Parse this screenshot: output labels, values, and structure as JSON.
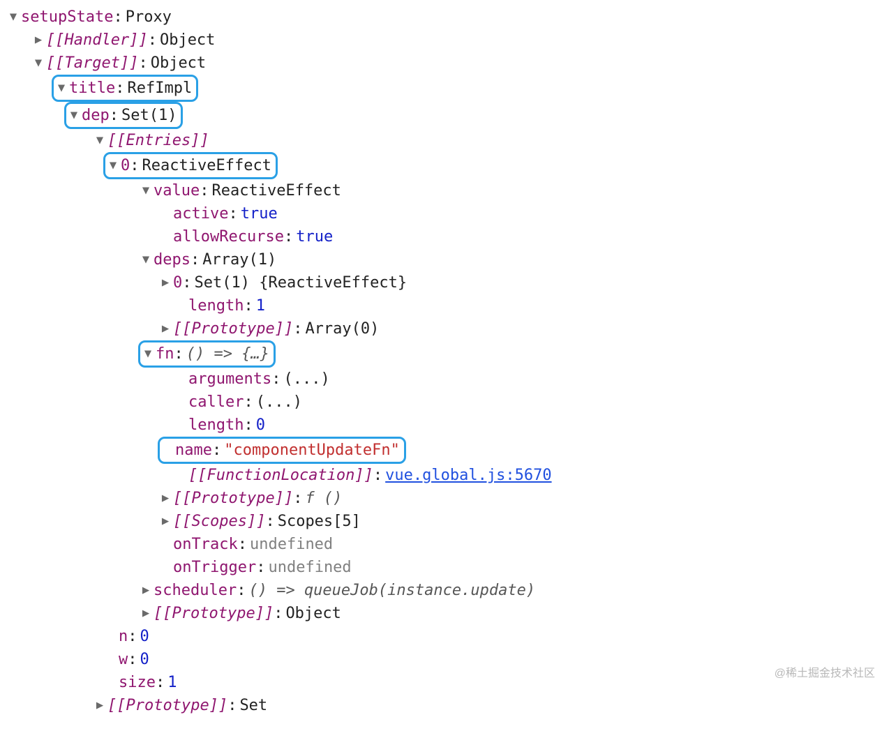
{
  "root": {
    "key": "setupState",
    "value": "Proxy"
  },
  "handler": {
    "key": "[[Handler]]",
    "value": "Object"
  },
  "target": {
    "key": "[[Target]]",
    "value": "Object"
  },
  "title": {
    "key": "title",
    "value": "RefImpl"
  },
  "dep": {
    "key": "dep",
    "value": "Set(1)"
  },
  "entriesLabel": "[[Entries]]",
  "entry0": {
    "key": "0",
    "value": "ReactiveEffect"
  },
  "valueRow": {
    "key": "value",
    "value": "ReactiveEffect"
  },
  "active": {
    "key": "active",
    "value": "true"
  },
  "allowRecurse": {
    "key": "allowRecurse",
    "value": "true"
  },
  "deps": {
    "key": "deps",
    "value": "Array(1)"
  },
  "deps0": {
    "key": "0",
    "value": "Set(1) {ReactiveEffect}"
  },
  "depsLength": {
    "key": "length",
    "value": "1"
  },
  "depsProto": {
    "key": "[[Prototype]]",
    "value": "Array(0)"
  },
  "fn": {
    "key": "fn",
    "value": "() => {…}"
  },
  "fnArgs": {
    "key": "arguments",
    "value": "(...)"
  },
  "fnCaller": {
    "key": "caller",
    "value": "(...)"
  },
  "fnLength": {
    "key": "length",
    "value": "0"
  },
  "fnName": {
    "key": "name",
    "value": "\"componentUpdateFn\""
  },
  "fnLoc": {
    "key": "[[FunctionLocation]]",
    "value": "vue.global.js:5670"
  },
  "fnProto": {
    "key": "[[Prototype]]",
    "value": "f ()"
  },
  "fnScopes": {
    "key": "[[Scopes]]",
    "value": "Scopes[5]"
  },
  "onTrack": {
    "key": "onTrack",
    "value": "undefined"
  },
  "onTrigger": {
    "key": "onTrigger",
    "value": "undefined"
  },
  "scheduler": {
    "key": "scheduler",
    "value": "() => queueJob(instance.update)"
  },
  "effProto": {
    "key": "[[Prototype]]",
    "value": "Object"
  },
  "n": {
    "key": "n",
    "value": "0"
  },
  "w": {
    "key": "w",
    "value": "0"
  },
  "size": {
    "key": "size",
    "value": "1"
  },
  "setProto": {
    "key": "[[Prototype]]",
    "value": "Set"
  },
  "watermark": "@稀土掘金技术社区"
}
